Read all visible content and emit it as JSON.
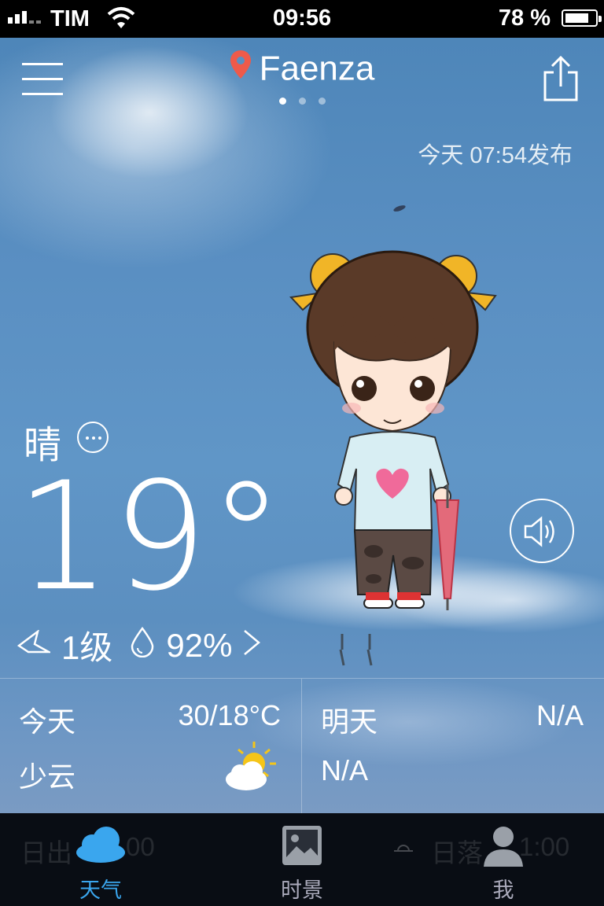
{
  "status_bar": {
    "carrier": "TIM",
    "time": "09:56",
    "battery": "78 %",
    "battery_level": 0.78
  },
  "header": {
    "location": "Faenza",
    "page_dots": {
      "count": 3,
      "active": 0
    },
    "published": "今天 07:54发布"
  },
  "current": {
    "condition": "晴",
    "temperature": "19°",
    "wind": "1级",
    "humidity": "92%"
  },
  "forecast": {
    "today": {
      "day": "今天",
      "temp": "30/18°C",
      "condition": "少云",
      "icon": "partly-cloudy-icon"
    },
    "tomorrow": {
      "day": "明天",
      "temp": "N/A",
      "condition": "N/A"
    }
  },
  "ghost_row": {
    "sunrise": "日出",
    "sunrise_time": "00",
    "sunset": "日落",
    "sunset_time": "1:00"
  },
  "tabs": [
    {
      "label": "天气",
      "icon": "cloud-icon",
      "active": true
    },
    {
      "label": "时景",
      "icon": "picture-icon",
      "active": false
    },
    {
      "label": "我",
      "icon": "person-icon",
      "active": false
    }
  ],
  "colors": {
    "accent": "#3aa6ee",
    "pin": "#ef5a4a",
    "sky": "#5a8fc2"
  }
}
